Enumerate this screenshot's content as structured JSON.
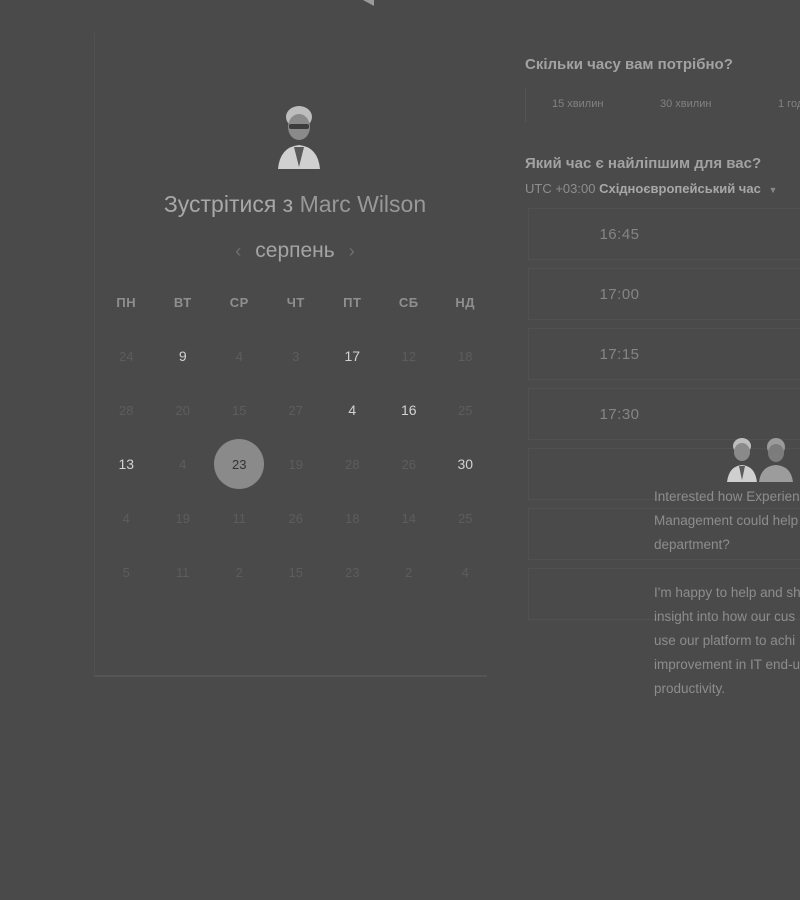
{
  "scheduler": {
    "title_prefix": "Зустрітися з",
    "host_name": "Marc Wilson",
    "month": "серпень",
    "prev_icon": "‹",
    "next_icon": "›",
    "weekdays": [
      "ПН",
      "ВТ",
      "СР",
      "ЧТ",
      "ПТ",
      "СБ",
      "НД"
    ],
    "days": [
      {
        "label": "24",
        "state": "muted"
      },
      {
        "label": "9",
        "state": "available"
      },
      {
        "label": "4",
        "state": "muted"
      },
      {
        "label": "3",
        "state": "muted"
      },
      {
        "label": "17",
        "state": "available"
      },
      {
        "label": "12",
        "state": "muted"
      },
      {
        "label": "18",
        "state": "muted"
      },
      {
        "label": "28",
        "state": "muted"
      },
      {
        "label": "20",
        "state": "muted"
      },
      {
        "label": "15",
        "state": "muted"
      },
      {
        "label": "27",
        "state": "muted"
      },
      {
        "label": "4",
        "state": "available"
      },
      {
        "label": "16",
        "state": "available"
      },
      {
        "label": "25",
        "state": "muted"
      },
      {
        "label": "13",
        "state": "available"
      },
      {
        "label": "4",
        "state": "muted"
      },
      {
        "label": "23",
        "state": "selected"
      },
      {
        "label": "19",
        "state": "muted"
      },
      {
        "label": "28",
        "state": "muted"
      },
      {
        "label": "26",
        "state": "muted"
      },
      {
        "label": "30",
        "state": "available"
      },
      {
        "label": "4",
        "state": "muted"
      },
      {
        "label": "19",
        "state": "muted"
      },
      {
        "label": "11",
        "state": "muted"
      },
      {
        "label": "26",
        "state": "muted"
      },
      {
        "label": "18",
        "state": "muted"
      },
      {
        "label": "14",
        "state": "muted"
      },
      {
        "label": "25",
        "state": "muted"
      },
      {
        "label": "5",
        "state": "muted"
      },
      {
        "label": "11",
        "state": "muted"
      },
      {
        "label": "2",
        "state": "muted"
      },
      {
        "label": "15",
        "state": "muted"
      },
      {
        "label": "23",
        "state": "muted"
      },
      {
        "label": "2",
        "state": "muted"
      },
      {
        "label": "4",
        "state": "muted"
      }
    ]
  },
  "booking": {
    "duration_question": "Скільки часу вам потрібно?",
    "durations": [
      "15 хвилин",
      "30 хвилин",
      "1 год"
    ],
    "time_question": "Який час є найліпшим для вас?",
    "timezone_offset": "UTC +03:00",
    "timezone_name": "Східноєвропейський час",
    "slots": [
      "16:45",
      "17:00",
      "17:15",
      "17:30",
      "",
      "",
      ""
    ]
  },
  "popup": {
    "paragraphs": [
      [
        "Interested how Experien",
        "Management could help",
        "department?"
      ],
      [
        "I'm happy to help and sh",
        "insight into how our cus",
        "use our platform to achi",
        "improvement in IT end-u",
        "productivity."
      ]
    ]
  },
  "colors": {
    "background": "#4a4a4a",
    "selected_day": "#8a8a8a",
    "available_day": "#d2d2d2",
    "muted_day": "#5d5d5d"
  }
}
